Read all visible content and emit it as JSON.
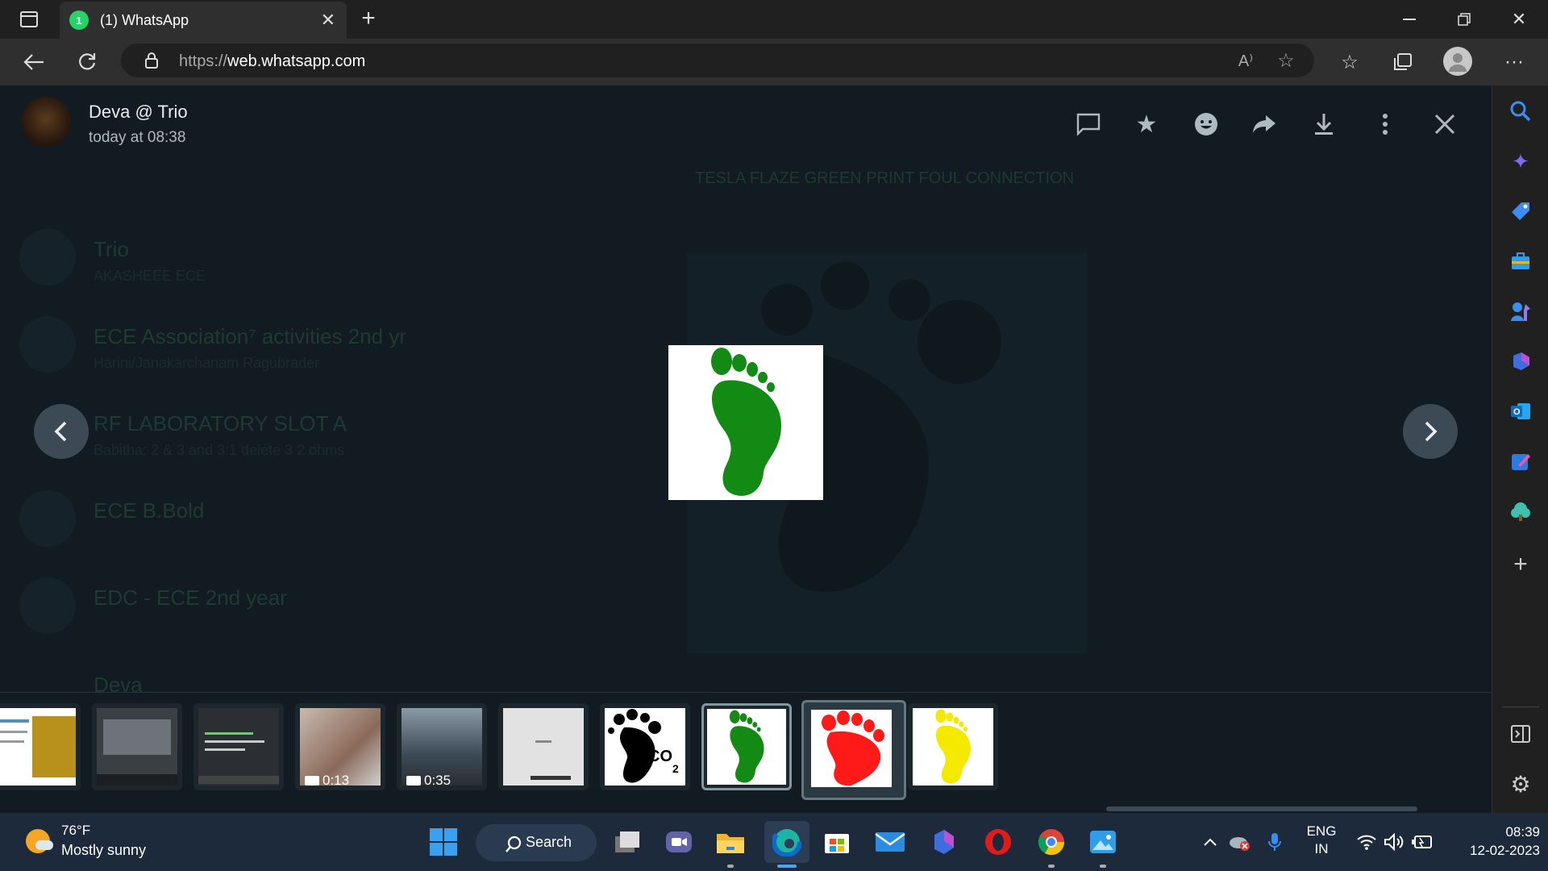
{
  "browser": {
    "tab_title": "(1) WhatsApp",
    "tab_badge": "1",
    "url_prefix": "https://",
    "url_host": "web.whatsapp.com"
  },
  "viewer": {
    "sender_name": "Deva @ Trio",
    "timestamp": "today at 08:38",
    "background_chats": [
      {
        "title": "Trio",
        "subtitle": "AKASHEEE ECE"
      },
      {
        "title": "ECE Association⁷ activities 2nd yr",
        "subtitle": "Harini/Janakarchanam Ragubrader"
      },
      {
        "title": "RF LABORATORY SLOT A",
        "subtitle": "Babitha: 2 & 3 and 3:1 delete 3 2 ohms"
      },
      {
        "title": "ECE B.Bold",
        "subtitle": ""
      },
      {
        "title": "EDC - ECE 2nd year",
        "subtitle": ""
      },
      {
        "title": "Deva",
        "subtitle": ""
      }
    ],
    "background_banner": "TESLA FLAZE GREEN PRINT FOUL CONNECTION",
    "thumbnails": [
      {
        "kind": "doc-yellow",
        "duration": ""
      },
      {
        "kind": "screen-dark",
        "duration": ""
      },
      {
        "kind": "code",
        "duration": ""
      },
      {
        "kind": "video-blur",
        "duration": "0:13"
      },
      {
        "kind": "video-screen",
        "duration": "0:35"
      },
      {
        "kind": "paper",
        "duration": ""
      },
      {
        "kind": "foot-black-co2",
        "duration": ""
      },
      {
        "kind": "foot-green",
        "duration": ""
      },
      {
        "kind": "foot-red",
        "duration": ""
      },
      {
        "kind": "foot-yellow",
        "duration": ""
      }
    ],
    "colors": {
      "green_foot": "#138a13",
      "red_foot": "#ff1a1a",
      "yellow_foot": "#f5e900"
    }
  },
  "taskbar": {
    "weather_temp": "76°F",
    "weather_desc": "Mostly sunny",
    "search_label": "Search",
    "lang_top": "ENG",
    "lang_bottom": "IN",
    "time": "08:39",
    "date": "12-02-2023"
  }
}
